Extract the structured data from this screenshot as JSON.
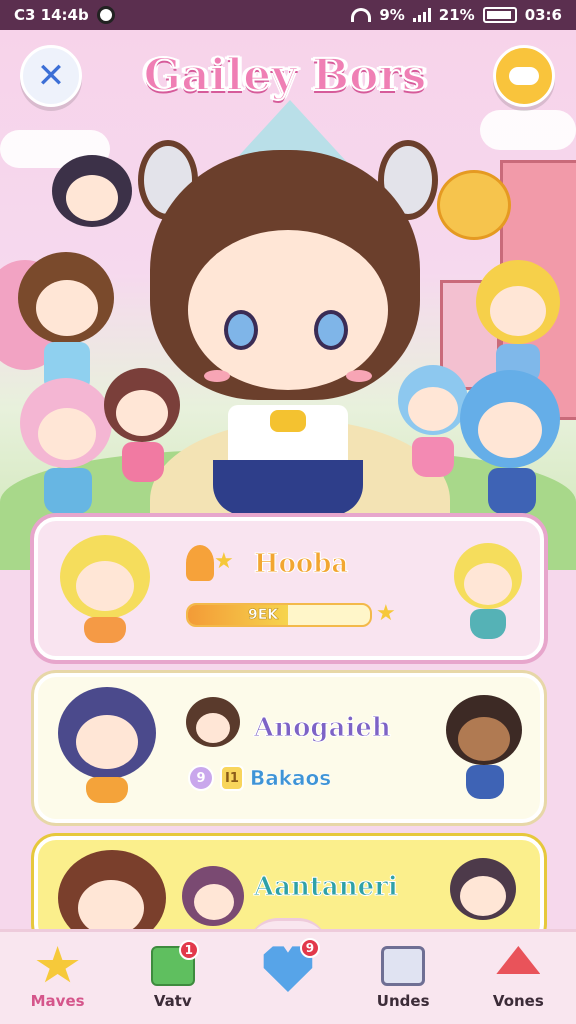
{
  "status_bar": {
    "left_text": "C3 14:4b",
    "wifi_text": "9%",
    "battery_text": "21%",
    "time_right": "03:6"
  },
  "header": {
    "title": "Gailey Bors"
  },
  "cards": [
    {
      "title": "Hooba",
      "progress_label": "9EK",
      "progress_value": 0.55
    },
    {
      "title": "Anogaieh",
      "badge_1": "9",
      "badge_2": "I1",
      "stat_text": "Bakaos"
    },
    {
      "title": "Aantaneri"
    }
  ],
  "bottom_nav": {
    "items": [
      {
        "label": "Maves",
        "icon": "star-icon",
        "badge": ""
      },
      {
        "label": "Vatv",
        "icon": "envelope-icon",
        "badge": "1"
      },
      {
        "label": "",
        "icon": "heart-icon",
        "badge": "9"
      },
      {
        "label": "Undes",
        "icon": "box-icon",
        "badge": ""
      },
      {
        "label": "Vones",
        "icon": "house-icon",
        "badge": ""
      }
    ]
  },
  "colors": {
    "accent_pink": "#ef7fb4",
    "progress_orange": "#f39b37",
    "badge_red": "#e2394b"
  }
}
